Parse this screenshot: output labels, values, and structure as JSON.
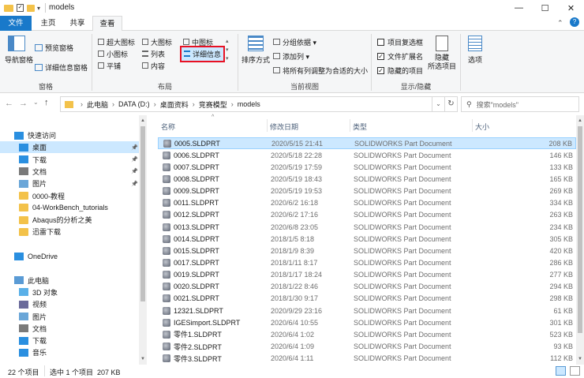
{
  "window": {
    "title": "models",
    "minimize": "—",
    "maximize": "☐",
    "close": "✕"
  },
  "ribbon_tabs": [
    "文件",
    "主页",
    "共享",
    "查看"
  ],
  "ribbon": {
    "pane_group": {
      "nav_pane": "导航窗格",
      "preview_pane": "预览窗格",
      "details_pane": "详细信息窗格",
      "label": "窗格"
    },
    "layout_group": {
      "items": [
        "超大图标",
        "大图标",
        "中图标",
        "小图标",
        "列表",
        "详细信息",
        "平铺",
        "内容"
      ],
      "label": "布局"
    },
    "current_view_group": {
      "sort_by": "排序方式",
      "group_by": "分组依据",
      "add_column": "添加列",
      "fit_columns": "将所有列调整为合适的大小",
      "label": "当前视图"
    },
    "show_hide_group": {
      "item_checkboxes": "项目复选框",
      "file_extensions": "文件扩展名",
      "hidden_items": "隐藏的项目",
      "hide_selected": "隐藏\n所选项目",
      "label": "显示/隐藏",
      "checks": {
        "item_checkboxes": false,
        "file_extensions": true,
        "hidden_items": true
      }
    },
    "options": "选项"
  },
  "address": {
    "crumbs": [
      "此电脑",
      "DATA (D:)",
      "桌面资料",
      "竞赛模型",
      "models"
    ],
    "search_placeholder": "搜索\"models\""
  },
  "nav": [
    {
      "label": "快速访问",
      "icon": "star-icon",
      "indent": 0
    },
    {
      "label": "桌面",
      "icon": "desktop-icon",
      "indent": 1,
      "pinned": true,
      "selected": true
    },
    {
      "label": "下载",
      "icon": "download-icon",
      "indent": 1,
      "pinned": true
    },
    {
      "label": "文档",
      "icon": "document-icon",
      "indent": 1,
      "pinned": true
    },
    {
      "label": "图片",
      "icon": "picture-icon",
      "indent": 1,
      "pinned": true
    },
    {
      "label": "0000-教程",
      "icon": "folder-icon",
      "indent": 1
    },
    {
      "label": "04-WorkBench_tutorials",
      "icon": "folder-icon",
      "indent": 1
    },
    {
      "label": "Abaqus的分析之美",
      "icon": "folder-icon",
      "indent": 1
    },
    {
      "label": "迅雷下载",
      "icon": "folder-icon",
      "indent": 1
    },
    {
      "label": "",
      "icon": "",
      "indent": 0
    },
    {
      "label": "OneDrive",
      "icon": "cloud-icon",
      "indent": 0
    },
    {
      "label": "",
      "icon": "",
      "indent": 0
    },
    {
      "label": "此电脑",
      "icon": "pc-icon",
      "indent": 0
    },
    {
      "label": "3D 对象",
      "icon": "cube-icon",
      "indent": 1
    },
    {
      "label": "视频",
      "icon": "video-icon",
      "indent": 1
    },
    {
      "label": "图片",
      "icon": "picture-icon",
      "indent": 1
    },
    {
      "label": "文档",
      "icon": "document-icon",
      "indent": 1
    },
    {
      "label": "下载",
      "icon": "download-icon",
      "indent": 1
    },
    {
      "label": "音乐",
      "icon": "music-icon",
      "indent": 1
    }
  ],
  "columns": {
    "name": "名称",
    "date": "修改日期",
    "type": "类型",
    "size": "大小"
  },
  "files": [
    {
      "name": "0005.SLDPRT",
      "date": "2020/5/15 21:41",
      "type": "SOLIDWORKS Part Document",
      "size": "208 KB",
      "selected": true
    },
    {
      "name": "0006.SLDPRT",
      "date": "2020/5/18 22:28",
      "type": "SOLIDWORKS Part Document",
      "size": "146 KB"
    },
    {
      "name": "0007.SLDPRT",
      "date": "2020/5/19 17:59",
      "type": "SOLIDWORKS Part Document",
      "size": "133 KB"
    },
    {
      "name": "0008.SLDPRT",
      "date": "2020/5/19 18:43",
      "type": "SOLIDWORKS Part Document",
      "size": "165 KB"
    },
    {
      "name": "0009.SLDPRT",
      "date": "2020/5/19 19:53",
      "type": "SOLIDWORKS Part Document",
      "size": "269 KB"
    },
    {
      "name": "0011.SLDPRT",
      "date": "2020/6/2 16:18",
      "type": "SOLIDWORKS Part Document",
      "size": "334 KB"
    },
    {
      "name": "0012.SLDPRT",
      "date": "2020/6/2 17:16",
      "type": "SOLIDWORKS Part Document",
      "size": "263 KB"
    },
    {
      "name": "0013.SLDPRT",
      "date": "2020/6/8 23:05",
      "type": "SOLIDWORKS Part Document",
      "size": "234 KB"
    },
    {
      "name": "0014.SLDPRT",
      "date": "2018/1/5 8:18",
      "type": "SOLIDWORKS Part Document",
      "size": "305 KB"
    },
    {
      "name": "0015.SLDPRT",
      "date": "2018/1/9 8:39",
      "type": "SOLIDWORKS Part Document",
      "size": "420 KB"
    },
    {
      "name": "0017.SLDPRT",
      "date": "2018/1/11 8:17",
      "type": "SOLIDWORKS Part Document",
      "size": "286 KB"
    },
    {
      "name": "0019.SLDPRT",
      "date": "2018/1/17 18:24",
      "type": "SOLIDWORKS Part Document",
      "size": "277 KB"
    },
    {
      "name": "0020.SLDPRT",
      "date": "2018/1/22 8:46",
      "type": "SOLIDWORKS Part Document",
      "size": "294 KB"
    },
    {
      "name": "0021.SLDPRT",
      "date": "2018/1/30 9:17",
      "type": "SOLIDWORKS Part Document",
      "size": "298 KB"
    },
    {
      "name": "12321.SLDPRT",
      "date": "2020/9/29 23:16",
      "type": "SOLIDWORKS Part Document",
      "size": "61 KB"
    },
    {
      "name": "IGESimport.SLDPRT",
      "date": "2020/6/4 10:55",
      "type": "SOLIDWORKS Part Document",
      "size": "301 KB"
    },
    {
      "name": "零件1.SLDPRT",
      "date": "2020/6/4 1:02",
      "type": "SOLIDWORKS Part Document",
      "size": "523 KB"
    },
    {
      "name": "零件2.SLDPRT",
      "date": "2020/6/4 1:09",
      "type": "SOLIDWORKS Part Document",
      "size": "93 KB"
    },
    {
      "name": "零件3.SLDPRT",
      "date": "2020/6/4 1:11",
      "type": "SOLIDWORKS Part Document",
      "size": "112 KB"
    }
  ],
  "status": {
    "count": "22 个项目",
    "selection": "选中 1 个项目  207 KB"
  },
  "colors": {
    "accent": "#1979ca",
    "selection": "#cce8ff",
    "highlight_box": "#e81123"
  }
}
